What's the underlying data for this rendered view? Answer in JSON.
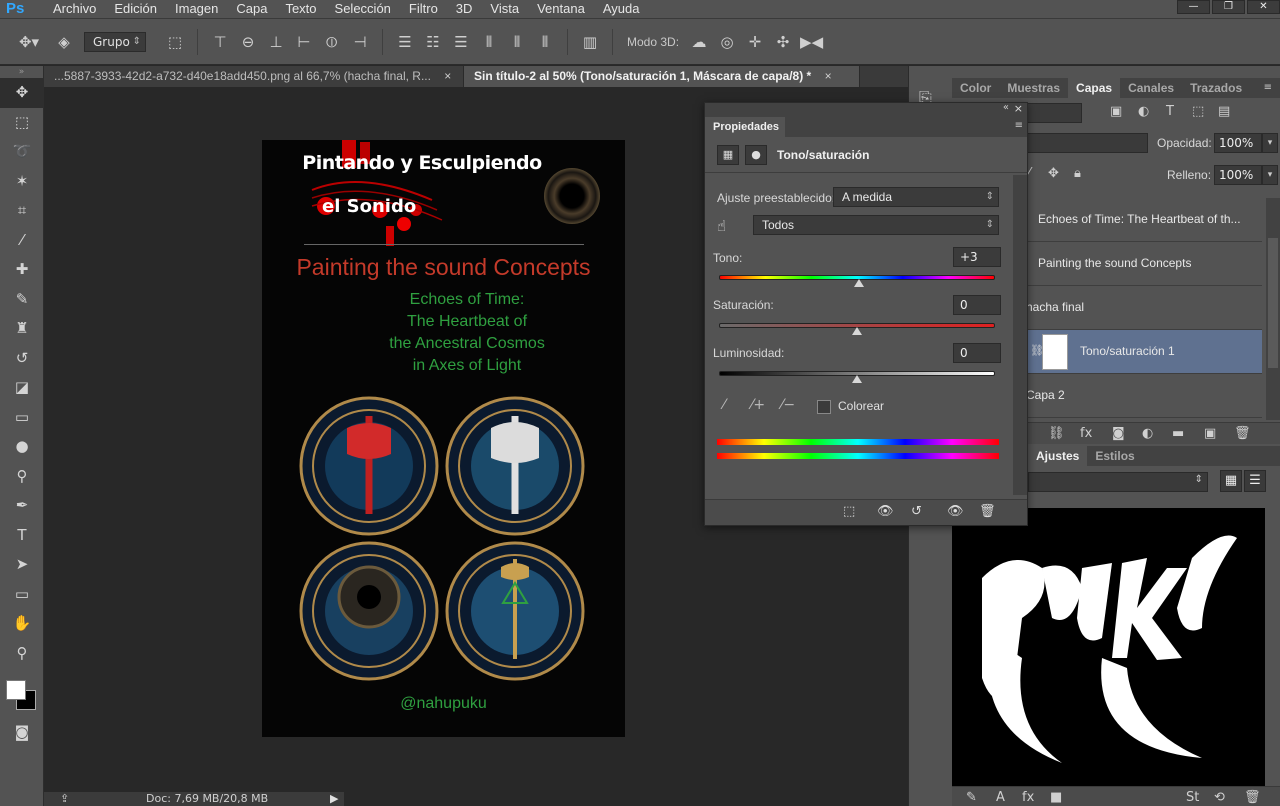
{
  "app": {
    "logo": "Ps"
  },
  "menu": [
    "Archivo",
    "Edición",
    "Imagen",
    "Capa",
    "Texto",
    "Selección",
    "Filtro",
    "3D",
    "Vista",
    "Ventana",
    "Ayuda"
  ],
  "window_controls": {
    "minimize": "—",
    "restore": "❐",
    "close": "✕"
  },
  "options_bar": {
    "autoselect_value": "Grupo",
    "mode3d_label": "Modo 3D:"
  },
  "doc_tabs": [
    {
      "label": "...5887-3933-42d2-a732-d40e18add450.png al 66,7% (hacha final, R...",
      "close": "×"
    },
    {
      "label": "Sin título-2 al 50% (Tono/saturación 1, Máscara de capa/8) *",
      "close": "×"
    }
  ],
  "artwork": {
    "title_es_1": "Pintando y Esculpiendo",
    "title_es_2": "el Sonido",
    "title_en": "Painting the sound Concepts",
    "echoes": [
      "Echoes of Time:",
      "The Heartbeat of",
      "the Ancestral Cosmos",
      "in Axes of Light"
    ],
    "handle": "@nahupuku"
  },
  "status_bar": {
    "doc": "Doc: 7,69 MB/20,8 MB",
    "arrow": "▶"
  },
  "layers_panel": {
    "tabs": [
      "Color",
      "Muestras",
      "Capas",
      "Canales",
      "Trazados"
    ],
    "active_tab": "Capas",
    "opacity_label": "Opacidad:",
    "opacity_value": "100%",
    "fill_label": "Relleno:",
    "fill_value": "100%",
    "layers": [
      {
        "name": "Echoes of Time:  The Heartbeat of  th..."
      },
      {
        "name": "Painting the sound Concepts"
      },
      {
        "name": "hacha final"
      },
      {
        "name": "Tono/saturación 1"
      },
      {
        "name": "Capa 2"
      }
    ]
  },
  "adjust_panel": {
    "tabs": [
      "Ajustes",
      "Estilos"
    ]
  },
  "properties": {
    "tab": "Propiedades",
    "title": "Tono/saturación",
    "preset_label": "Ajuste preestablecido:",
    "preset_value": "A medida",
    "channel_value": "Todos",
    "hue_label": "Tono:",
    "hue_value": "+3",
    "saturation_label": "Saturación:",
    "saturation_value": "0",
    "lightness_label": "Luminosidad:",
    "lightness_value": "0",
    "colorize_label": "Colorear",
    "sliders": {
      "hue": 3,
      "hue_min": -180,
      "hue_max": 180,
      "saturation": 0,
      "sat_min": -100,
      "sat_max": 100,
      "lightness": 0,
      "light_min": -100,
      "light_max": 100
    }
  }
}
